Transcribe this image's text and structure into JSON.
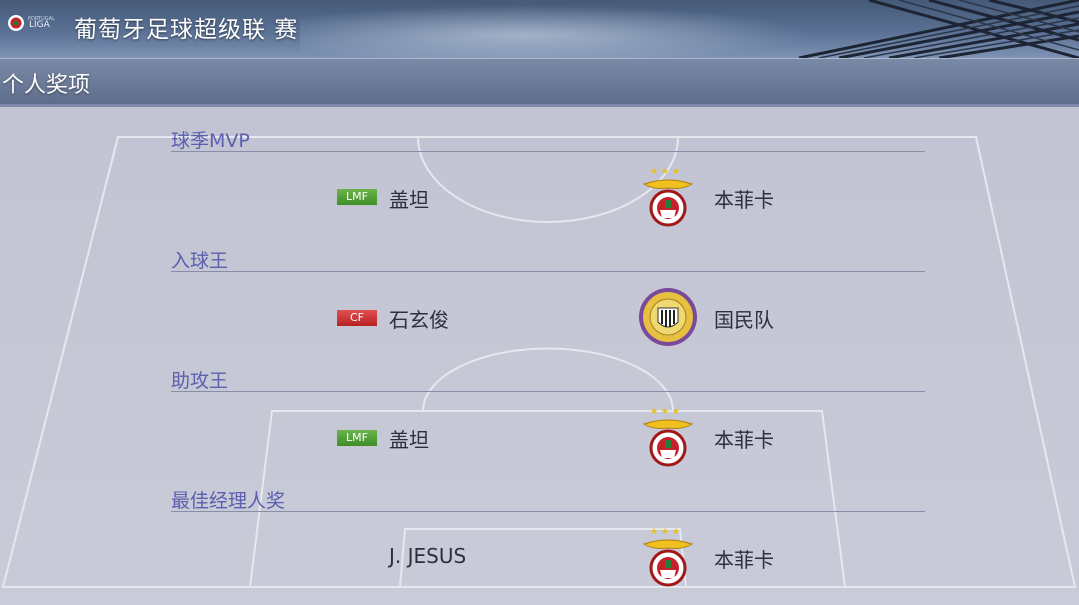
{
  "header": {
    "title": "葡萄牙足球超级联 赛",
    "logo_text": "LIGA"
  },
  "section": {
    "title": "个人奖项"
  },
  "awards": [
    {
      "label": "球季MVP",
      "position": "LMF",
      "position_color": "#4a9a32",
      "player": "盖坦",
      "club_icon": "benfica-crest-icon",
      "club": "本菲卡"
    },
    {
      "label": "入球王",
      "position": "CF",
      "position_color": "#c62a2a",
      "player": "石玄俊",
      "club_icon": "national-team-crest-icon",
      "club": "国民队"
    },
    {
      "label": "助攻王",
      "position": "LMF",
      "position_color": "#4a9a32",
      "player": "盖坦",
      "club_icon": "benfica-crest-icon",
      "club": "本菲卡"
    },
    {
      "label": "最佳经理人奖",
      "player": "J.  JESUS",
      "club_icon": "benfica-crest-icon",
      "club": "本菲卡"
    }
  ],
  "colors": {
    "award_label": "#5c5fae",
    "text": "#2d2f3f",
    "header_bg": "#5a7195"
  }
}
